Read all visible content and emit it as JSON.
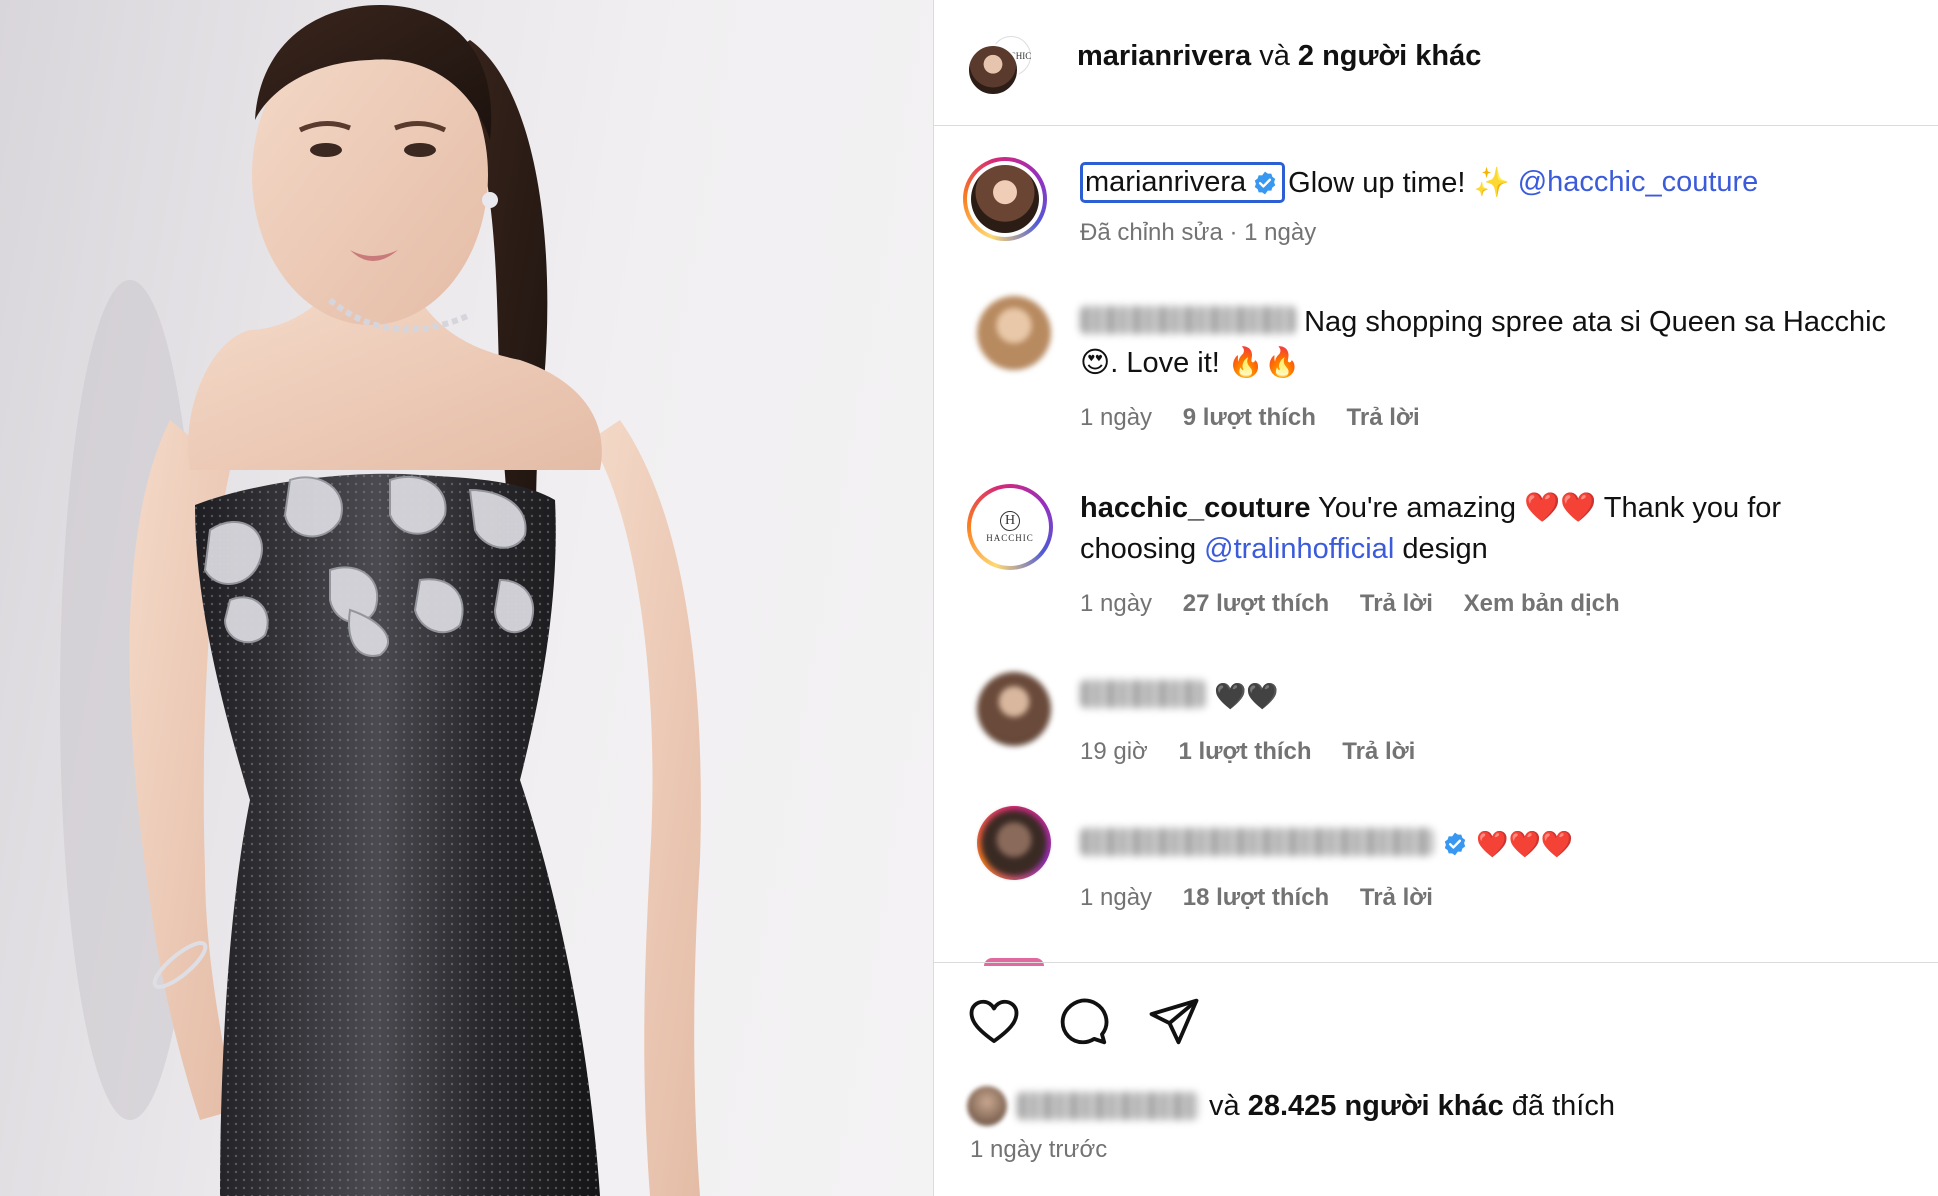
{
  "header": {
    "username": "marianrivera",
    "conjunction": "và",
    "others": "2 người khác",
    "second_avatar_text": "HACCHIC"
  },
  "caption": {
    "username": "marianrivera",
    "text": "Glow up time! ✨",
    "mention": "@hacchic_couture",
    "meta": "Đã chỉnh sửa · 1 ngày"
  },
  "comments": [
    {
      "username_blurred": true,
      "text_line1": "Nag shopping spree ata si Queen sa Hacchic",
      "text_line2": "😍. Love it! 🔥🔥",
      "time": "1 ngày",
      "likes": "9 lượt thích",
      "reply": "Trả lời"
    },
    {
      "username": "hacchic_couture",
      "text_a": "You're amazing ❤️❤️ Thank you for",
      "text_b": "choosing",
      "mention": "@tralinhofficial",
      "text_c": "design",
      "time": "1 ngày",
      "likes": "27 lượt thích",
      "reply": "Trả lời",
      "translate": "Xem bản dịch",
      "avatar_mono": "H",
      "avatar_brand": "HACCHIC"
    },
    {
      "username_blurred": true,
      "text": "🖤🖤",
      "time": "19 giờ",
      "likes": "1 lượt thích",
      "reply": "Trả lời"
    },
    {
      "username_blurred": true,
      "verified": true,
      "text": "❤️❤️❤️",
      "time": "1 ngày",
      "likes": "18 lượt thích",
      "reply": "Trả lời"
    }
  ],
  "likes_summary": {
    "conjunction": "và",
    "count_text": "28.425 người khác",
    "suffix": "đã thích"
  },
  "post_time": "1 ngày trước",
  "icons": [
    "heart-icon",
    "comment-icon",
    "share-icon",
    "verified-badge-icon"
  ],
  "colors": {
    "link": "#3b5bdb",
    "meta": "#737373",
    "verified": "#3897f0"
  }
}
